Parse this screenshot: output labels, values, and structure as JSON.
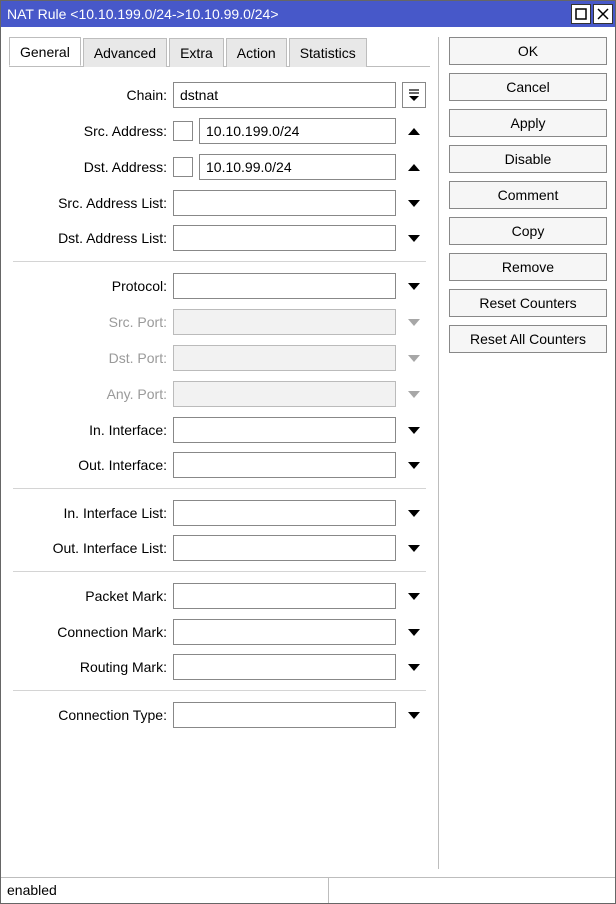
{
  "window": {
    "title": "NAT Rule <10.10.199.0/24->10.10.99.0/24>"
  },
  "tabs": {
    "general": "General",
    "advanced": "Advanced",
    "extra": "Extra",
    "action": "Action",
    "statistics": "Statistics",
    "active": "general"
  },
  "fields": {
    "chain": {
      "label": "Chain:",
      "value": "dstnat"
    },
    "src_address": {
      "label": "Src. Address:",
      "value": "10.10.199.0/24"
    },
    "dst_address": {
      "label": "Dst. Address:",
      "value": "10.10.99.0/24"
    },
    "src_address_list": {
      "label": "Src. Address List:",
      "value": ""
    },
    "dst_address_list": {
      "label": "Dst. Address List:",
      "value": ""
    },
    "protocol": {
      "label": "Protocol:",
      "value": ""
    },
    "src_port": {
      "label": "Src. Port:",
      "value": ""
    },
    "dst_port": {
      "label": "Dst. Port:",
      "value": ""
    },
    "any_port": {
      "label": "Any. Port:",
      "value": ""
    },
    "in_interface": {
      "label": "In. Interface:",
      "value": ""
    },
    "out_interface": {
      "label": "Out. Interface:",
      "value": ""
    },
    "in_interface_list": {
      "label": "In. Interface List:",
      "value": ""
    },
    "out_interface_list": {
      "label": "Out. Interface List:",
      "value": ""
    },
    "packet_mark": {
      "label": "Packet Mark:",
      "value": ""
    },
    "connection_mark": {
      "label": "Connection Mark:",
      "value": ""
    },
    "routing_mark": {
      "label": "Routing Mark:",
      "value": ""
    },
    "connection_type": {
      "label": "Connection Type:",
      "value": ""
    }
  },
  "buttons": {
    "ok": "OK",
    "cancel": "Cancel",
    "apply": "Apply",
    "disable": "Disable",
    "comment": "Comment",
    "copy": "Copy",
    "remove": "Remove",
    "reset_counters": "Reset Counters",
    "reset_all_counters": "Reset All Counters"
  },
  "status": {
    "state": "enabled"
  }
}
